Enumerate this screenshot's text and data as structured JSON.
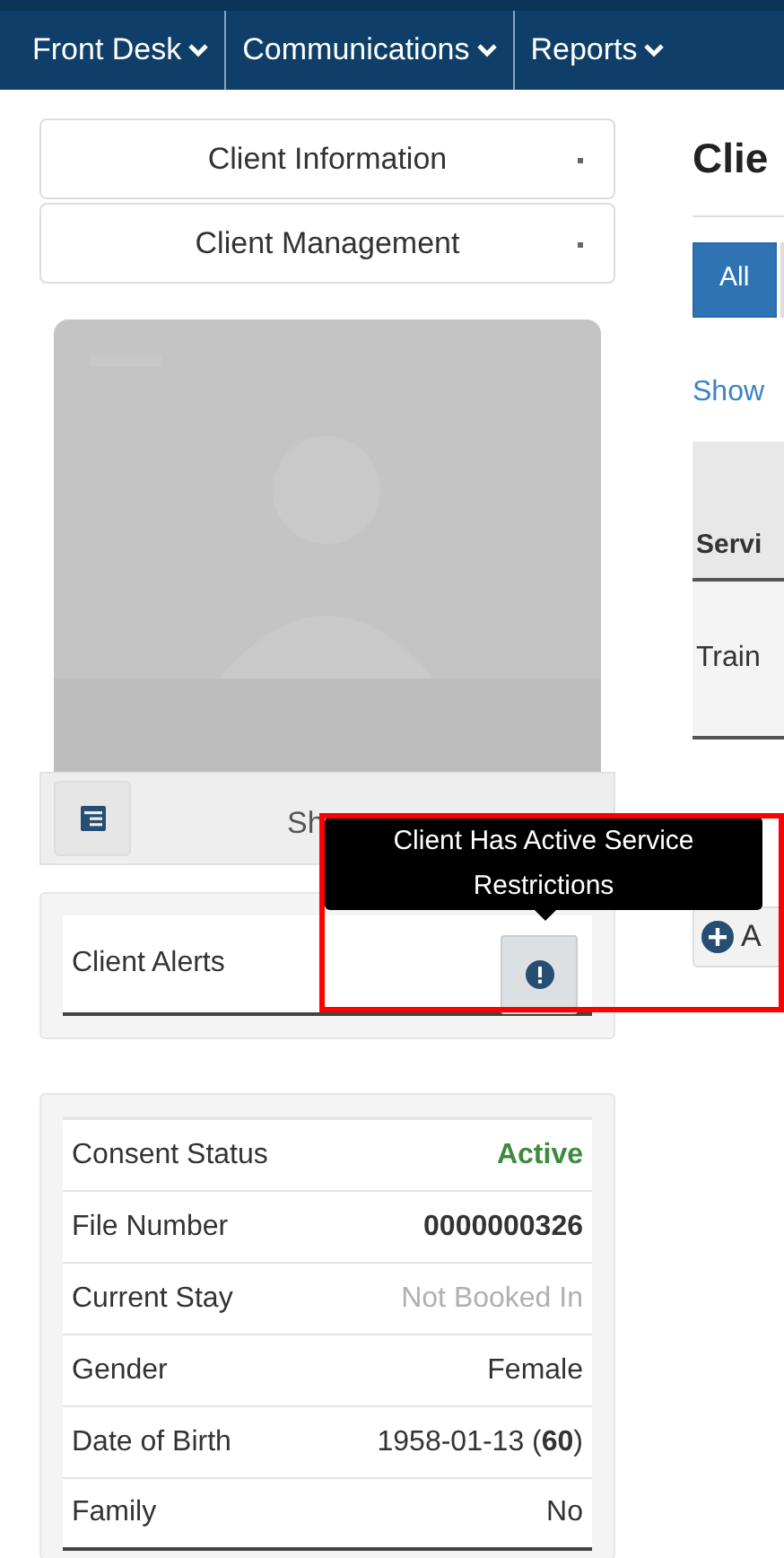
{
  "nav": {
    "items": [
      {
        "label": "Front Desk"
      },
      {
        "label": "Communications"
      },
      {
        "label": "Reports"
      }
    ]
  },
  "sidebar": {
    "menus": [
      {
        "label": "Client Information"
      },
      {
        "label": "Client Management"
      }
    ],
    "photo_bar": {
      "label": "Sh"
    },
    "alerts": {
      "label": "Client Alerts",
      "tooltip": "Client Has Active Service Restrictions",
      "highlighted": true
    },
    "details": [
      {
        "label": "Consent Status",
        "value": "Active",
        "kind": "status"
      },
      {
        "label": "File Number",
        "value": "0000000326",
        "kind": "bold"
      },
      {
        "label": "Current Stay",
        "value": "Not Booked In",
        "kind": "muted"
      },
      {
        "label": "Gender",
        "value": "Female",
        "kind": "plain"
      },
      {
        "label": "Date of Birth",
        "value": "1958-01-13 (**60**)",
        "kind": "plain"
      },
      {
        "label": "Family",
        "value": "No",
        "kind": "plain"
      }
    ]
  },
  "main": {
    "title": "Clie",
    "filters": [
      {
        "label": "All",
        "selected": true
      }
    ],
    "link": "Show",
    "table": {
      "columns": [
        "Servi"
      ],
      "rows": [
        [
          "Train"
        ]
      ]
    },
    "add_button": "A"
  }
}
